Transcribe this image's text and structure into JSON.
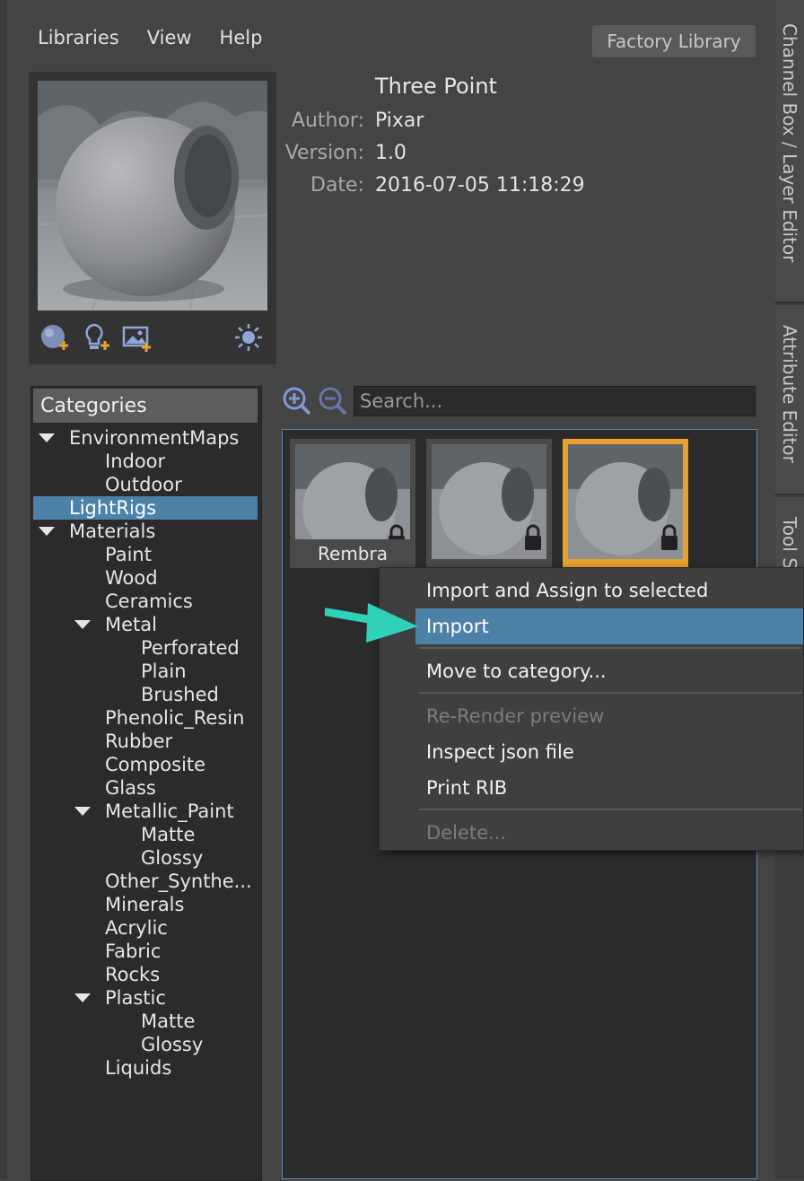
{
  "menubar": {
    "items": [
      "Libraries",
      "View",
      "Help"
    ],
    "library_button": "Factory Library"
  },
  "preview": {
    "title": "Three Point",
    "author_label": "Author:",
    "author": "Pixar",
    "version_label": "Version:",
    "version": "1.0",
    "date_label": "Date:",
    "date": "2016-07-05 11:18:29",
    "tool_icons": [
      "add-material-icon",
      "add-light-icon",
      "add-image-icon",
      "light-settings-icon"
    ]
  },
  "categories": {
    "header": "Categories",
    "items": [
      {
        "label": "EnvironmentMaps",
        "level": 0,
        "expanded": true
      },
      {
        "label": "Indoor",
        "level": 1
      },
      {
        "label": "Outdoor",
        "level": 1
      },
      {
        "label": "LightRigs",
        "level": 0,
        "selected": true
      },
      {
        "label": "Materials",
        "level": 0,
        "expanded": true
      },
      {
        "label": "Paint",
        "level": 1
      },
      {
        "label": "Wood",
        "level": 1
      },
      {
        "label": "Ceramics",
        "level": 1
      },
      {
        "label": "Metal",
        "level": 1,
        "expanded": true
      },
      {
        "label": "Perforated",
        "level": 2
      },
      {
        "label": "Plain",
        "level": 2
      },
      {
        "label": "Brushed",
        "level": 2
      },
      {
        "label": "Phenolic_Resin",
        "level": 1
      },
      {
        "label": "Rubber",
        "level": 1
      },
      {
        "label": "Composite",
        "level": 1
      },
      {
        "label": "Glass",
        "level": 1
      },
      {
        "label": "Metallic_Paint",
        "level": 1,
        "expanded": true
      },
      {
        "label": "Matte",
        "level": 2
      },
      {
        "label": "Glossy",
        "level": 2
      },
      {
        "label": "Other_Synthe...",
        "level": 1
      },
      {
        "label": "Minerals",
        "level": 1
      },
      {
        "label": "Acrylic",
        "level": 1
      },
      {
        "label": "Fabric",
        "level": 1
      },
      {
        "label": "Rocks",
        "level": 1
      },
      {
        "label": "Plastic",
        "level": 1,
        "expanded": true
      },
      {
        "label": "Matte",
        "level": 2
      },
      {
        "label": "Glossy",
        "level": 2
      },
      {
        "label": "Liquids",
        "level": 1
      }
    ]
  },
  "search": {
    "placeholder": "Search..."
  },
  "thumbnails": [
    {
      "label": "Rembra",
      "selected": false
    },
    {
      "label": "",
      "selected": false
    },
    {
      "label": "",
      "selected": true
    }
  ],
  "context_menu": {
    "items": [
      {
        "label": "Import and Assign to selected",
        "state": "normal"
      },
      {
        "label": "Import",
        "state": "highlighted"
      },
      {
        "label": "Move to category...",
        "state": "normal"
      },
      {
        "label": "Re-Render preview",
        "state": "disabled"
      },
      {
        "label": "Inspect json file",
        "state": "normal"
      },
      {
        "label": "Print RIB",
        "state": "normal"
      },
      {
        "label": "Delete...",
        "state": "disabled"
      }
    ]
  },
  "dock_tabs": [
    "Channel Box / Layer Editor",
    "Attribute Editor",
    "Tool S"
  ],
  "colors": {
    "accent": "#4d82a8",
    "selection_border": "#e8a12c",
    "arrow": "#2fd1b8"
  }
}
